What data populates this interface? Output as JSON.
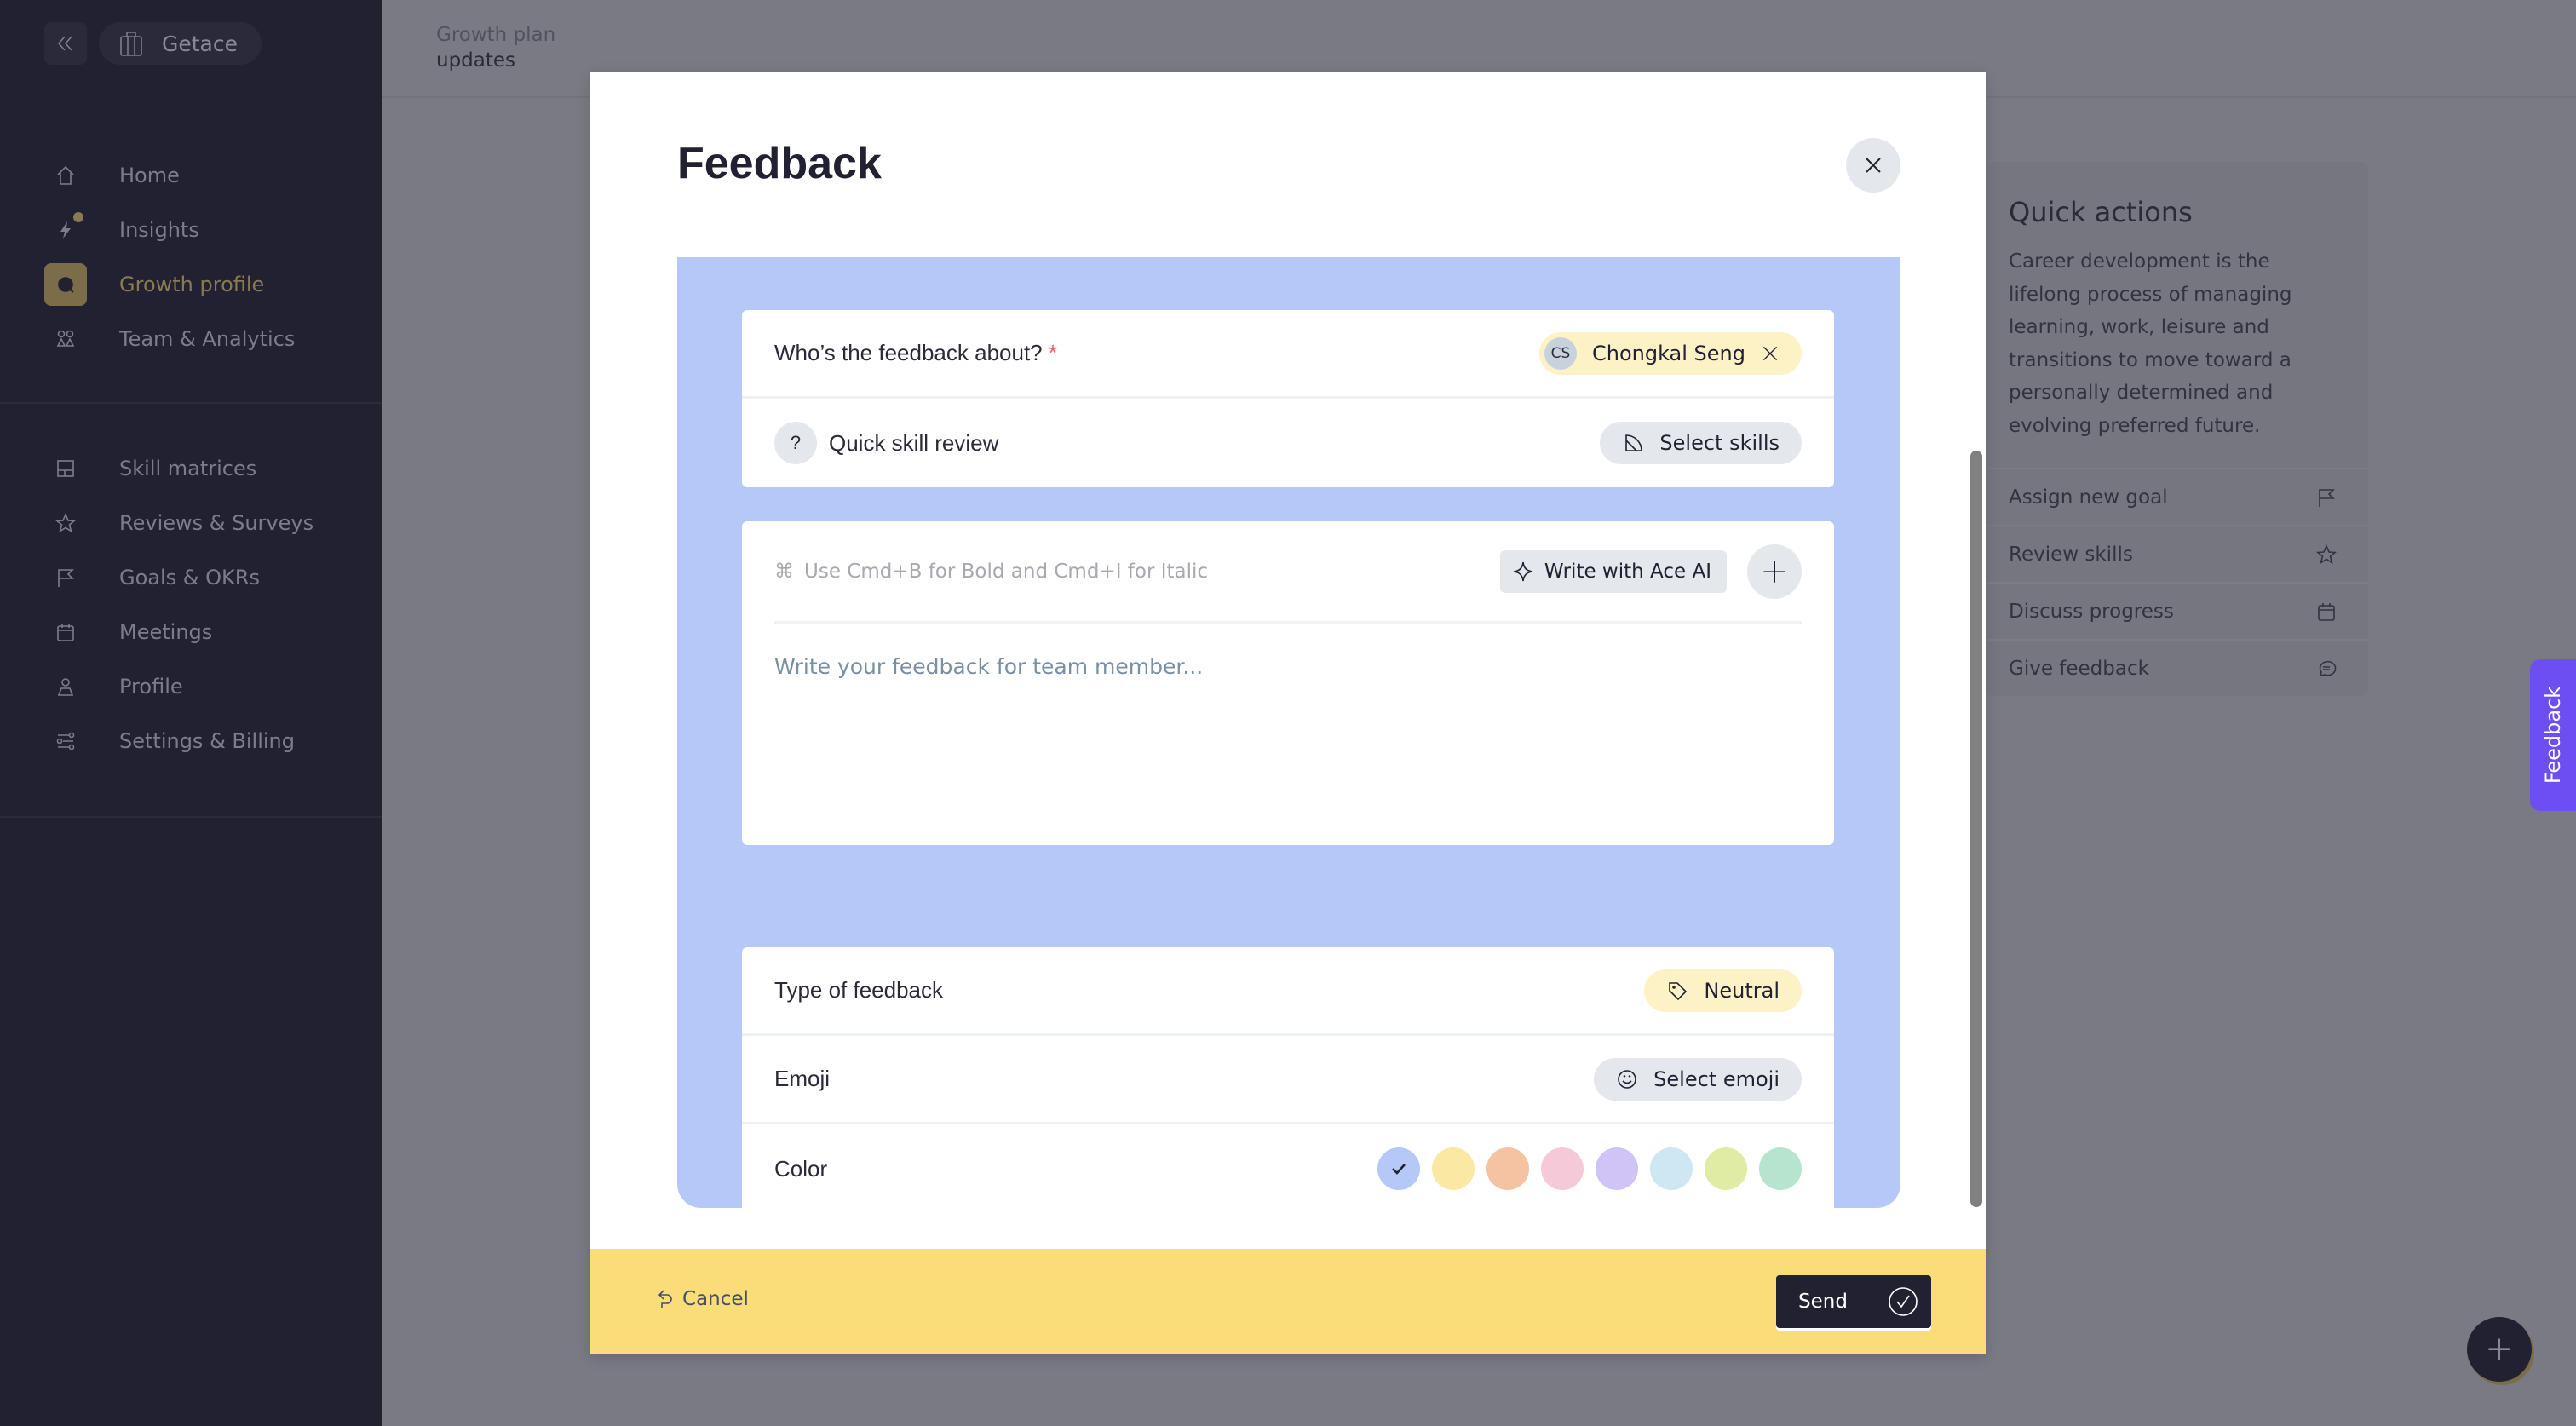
{
  "sidebar": {
    "org_name": "Getace",
    "primary_items": [
      {
        "label": "Home",
        "icon": "home-icon"
      },
      {
        "label": "Insights",
        "icon": "lightning-icon",
        "has_dot": true
      },
      {
        "label": "Growth profile",
        "icon": "leaf-icon",
        "active": true
      },
      {
        "label": "Team & Analytics",
        "icon": "team-icon"
      }
    ],
    "secondary_items": [
      {
        "label": "Skill matrices",
        "icon": "matrix-icon"
      },
      {
        "label": "Reviews & Surveys",
        "icon": "star-icon"
      },
      {
        "label": "Goals & OKRs",
        "icon": "flag-icon"
      },
      {
        "label": "Meetings",
        "icon": "calendar-icon"
      },
      {
        "label": "Profile",
        "icon": "user-icon"
      },
      {
        "label": "Settings & Billing",
        "icon": "sliders-icon"
      }
    ]
  },
  "header": {
    "breadcrumb_parent": "Growth plan",
    "breadcrumb_current": "updates"
  },
  "quick_actions": {
    "title": "Quick actions",
    "description": "Career development is the lifelong process of managing learning, work, leisure and transitions to move toward a personally determined and evolving preferred future.",
    "items": [
      {
        "label": "Assign new goal",
        "icon": "flag-icon"
      },
      {
        "label": "Review skills",
        "icon": "star-icon"
      },
      {
        "label": "Discuss progress",
        "icon": "calendar-icon"
      },
      {
        "label": "Give feedback",
        "icon": "chat-icon"
      }
    ]
  },
  "feedback_tab": "Feedback",
  "modal": {
    "title": "Feedback",
    "about_label": "Who’s the feedback about?",
    "required_mark": "*",
    "recipient": {
      "initials": "CS",
      "name": "Chongkal Seng"
    },
    "quick_skill_label": "Quick skill review",
    "quick_skill_icon_glyph": "?",
    "select_skills_label": "Select skills",
    "editor_hint": "Use Cmd+B for Bold and Cmd+I for Italic",
    "ai_button_label": "Write with Ace AI",
    "editor_placeholder": "Write your feedback for team member...",
    "editor_value": "",
    "type_label": "Type of feedback",
    "type_value": "Neutral",
    "emoji_label": "Emoji",
    "emoji_button_label": "Select emoji",
    "color_label": "Color",
    "colors": [
      "#b6c8f7",
      "#fbe9a3",
      "#f5c3a1",
      "#f5c9d8",
      "#d0c3f6",
      "#cfe6f3",
      "#e0eba4",
      "#b7e4ce"
    ],
    "selected_color_index": 0,
    "cancel_label": "Cancel",
    "send_label": "Send"
  },
  "colors": {
    "sidebar_bg": "#212131",
    "accent_gold": "#7c6d4a",
    "form_bg": "#b6c8f7",
    "footer_bg": "#f8dd78",
    "feedback_tab": "#6d4ef0"
  }
}
